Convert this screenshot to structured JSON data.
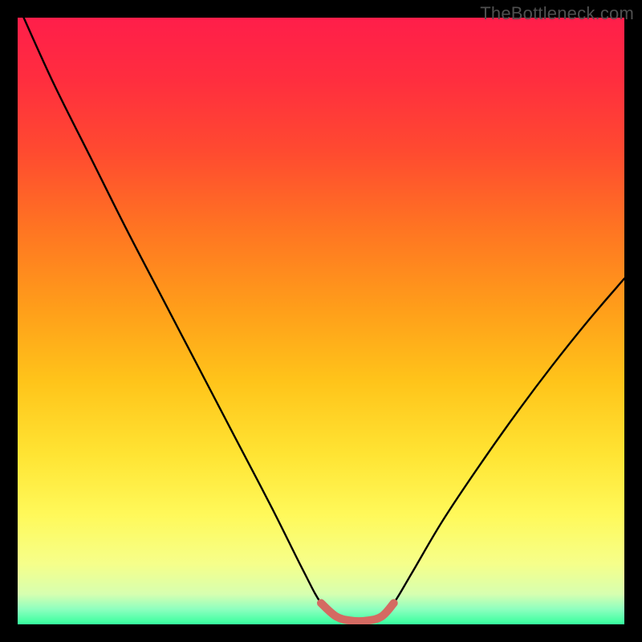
{
  "watermark": {
    "text": "TheBottleneck.com"
  },
  "colors": {
    "frame": "#000000",
    "gradient_stops": [
      {
        "offset": 0.0,
        "color": "#ff1e4a"
      },
      {
        "offset": 0.1,
        "color": "#ff2d3f"
      },
      {
        "offset": 0.22,
        "color": "#ff4a30"
      },
      {
        "offset": 0.35,
        "color": "#ff7522"
      },
      {
        "offset": 0.48,
        "color": "#ff9e1a"
      },
      {
        "offset": 0.6,
        "color": "#ffc41a"
      },
      {
        "offset": 0.72,
        "color": "#ffe433"
      },
      {
        "offset": 0.82,
        "color": "#fff95a"
      },
      {
        "offset": 0.9,
        "color": "#f6ff8a"
      },
      {
        "offset": 0.95,
        "color": "#d7ffb0"
      },
      {
        "offset": 0.975,
        "color": "#8effbf"
      },
      {
        "offset": 1.0,
        "color": "#35ff9d"
      }
    ],
    "curve": "#000000",
    "highlight": "#d46a62"
  },
  "chart_data": {
    "type": "line",
    "title": "",
    "xlabel": "",
    "ylabel": "",
    "xlim": [
      0,
      100
    ],
    "ylim": [
      0,
      100
    ],
    "series": [
      {
        "name": "bottleneck-curve",
        "x": [
          1,
          6,
          12,
          18,
          24,
          30,
          36,
          42,
          47,
          50,
          52.5,
          55,
          57.5,
          60,
          62,
          65,
          70,
          76,
          82,
          88,
          94,
          100
        ],
        "y": [
          100,
          89,
          77,
          65,
          53.5,
          42,
          30.5,
          19,
          9,
          3.5,
          1.3,
          0.6,
          0.6,
          1.3,
          3.5,
          8.5,
          17,
          26,
          34.5,
          42.5,
          50,
          57
        ]
      },
      {
        "name": "optimal-region",
        "x": [
          50,
          52.5,
          55,
          57.5,
          60,
          62
        ],
        "y": [
          3.5,
          1.3,
          0.6,
          0.6,
          1.3,
          3.5
        ]
      }
    ],
    "annotations": []
  }
}
